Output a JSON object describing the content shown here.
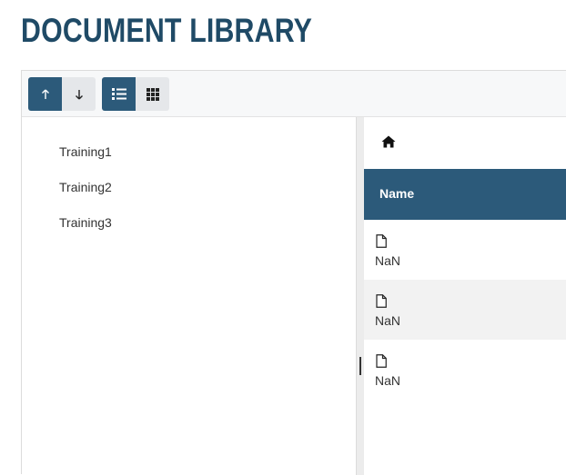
{
  "header": {
    "title": "DOCUMENT LIBRARY"
  },
  "toolbar": {
    "sort_ascending": {
      "icon": "arrow-up-icon",
      "active": true
    },
    "sort_descending": {
      "icon": "arrow-down-icon",
      "active": false
    },
    "view_list": {
      "icon": "list-icon",
      "active": true
    },
    "view_grid": {
      "icon": "grid-icon",
      "active": false
    }
  },
  "tree": {
    "items": [
      {
        "label": "Training1"
      },
      {
        "label": "Training2"
      },
      {
        "label": "Training3"
      }
    ]
  },
  "breadcrumb": {
    "icon": "home-icon"
  },
  "grid": {
    "columns": [
      {
        "label": "Name"
      }
    ],
    "rows": [
      {
        "icon": "file-icon",
        "name": "NaN"
      },
      {
        "icon": "file-icon",
        "name": "NaN"
      },
      {
        "icon": "file-icon",
        "name": "NaN"
      }
    ]
  },
  "colors": {
    "brand": "#2c5a7a",
    "title": "#1f4a66",
    "row_alt": "#f2f2f2"
  }
}
